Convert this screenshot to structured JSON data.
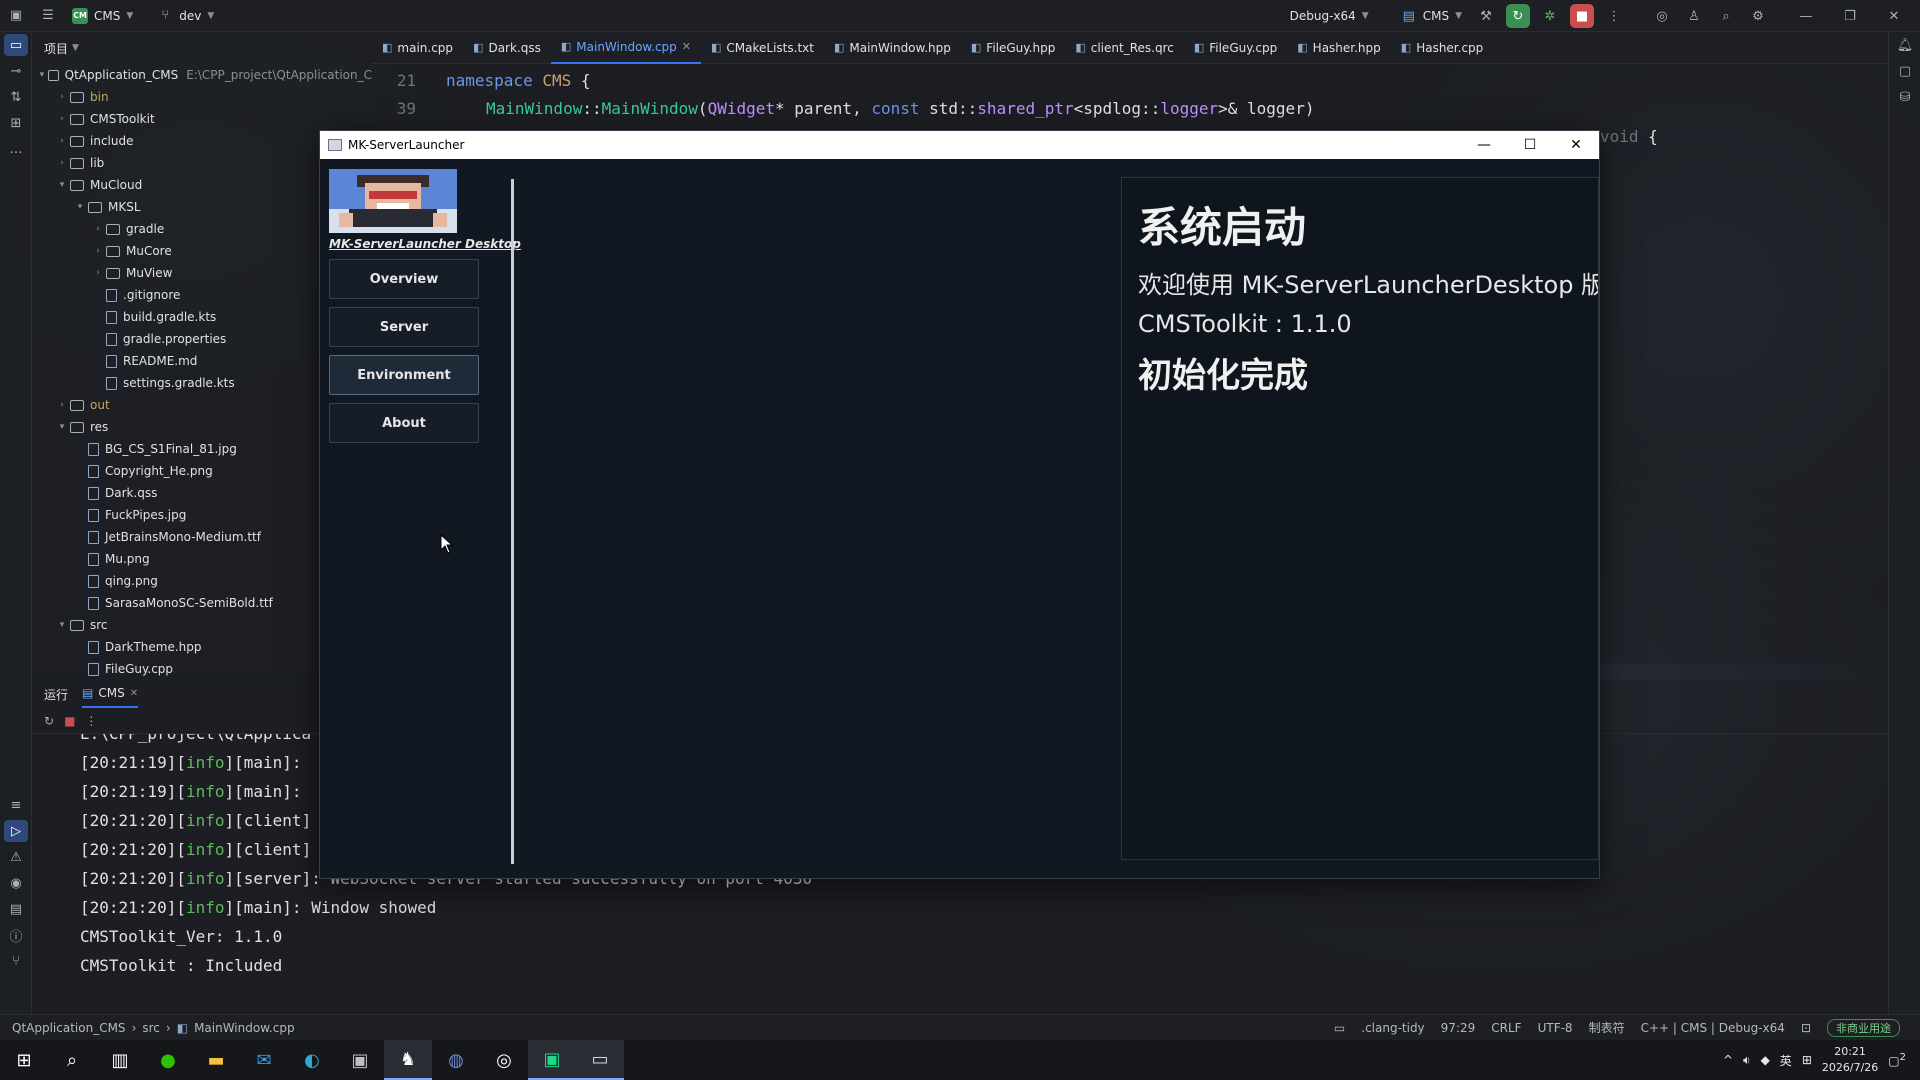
{
  "ide": {
    "project_name": "CMS",
    "branch": "dev",
    "build_config": "Debug-x64",
    "run_config": "CMS",
    "project_panel_title": "项目",
    "root_label": "QtApplication_CMS",
    "root_path": "E:\\CPP_project\\QtApplication_C",
    "tree": [
      {
        "label": "bin",
        "depth": 1,
        "type": "folder",
        "expanded": false,
        "style": "yellow"
      },
      {
        "label": "CMSToolkit",
        "depth": 1,
        "type": "folder",
        "expanded": false
      },
      {
        "label": "include",
        "depth": 1,
        "type": "folder",
        "expanded": false
      },
      {
        "label": "lib",
        "depth": 1,
        "type": "folder",
        "expanded": false
      },
      {
        "label": "MuCloud",
        "depth": 1,
        "type": "folder",
        "expanded": true
      },
      {
        "label": "MKSL",
        "depth": 2,
        "type": "folder",
        "expanded": true
      },
      {
        "label": "gradle",
        "depth": 3,
        "type": "folder",
        "expanded": false
      },
      {
        "label": "MuCore",
        "depth": 3,
        "type": "folder",
        "expanded": false
      },
      {
        "label": "MuView",
        "depth": 3,
        "type": "folder",
        "expanded": false
      },
      {
        "label": ".gitignore",
        "depth": 3,
        "type": "file"
      },
      {
        "label": "build.gradle.kts",
        "depth": 3,
        "type": "file"
      },
      {
        "label": "gradle.properties",
        "depth": 3,
        "type": "file"
      },
      {
        "label": "README.md",
        "depth": 3,
        "type": "file"
      },
      {
        "label": "settings.gradle.kts",
        "depth": 3,
        "type": "file"
      },
      {
        "label": "out",
        "depth": 1,
        "type": "folder",
        "expanded": false,
        "style": "yellow"
      },
      {
        "label": "res",
        "depth": 1,
        "type": "folder",
        "expanded": true
      },
      {
        "label": "BG_CS_S1Final_81.jpg",
        "depth": 2,
        "type": "file"
      },
      {
        "label": "Copyright_He.png",
        "depth": 2,
        "type": "file"
      },
      {
        "label": "Dark.qss",
        "depth": 2,
        "type": "file"
      },
      {
        "label": "FuckPipes.jpg",
        "depth": 2,
        "type": "file"
      },
      {
        "label": "JetBrainsMono-Medium.ttf",
        "depth": 2,
        "type": "file"
      },
      {
        "label": "Mu.png",
        "depth": 2,
        "type": "file"
      },
      {
        "label": "qing.png",
        "depth": 2,
        "type": "file"
      },
      {
        "label": "SarasaMonoSC-SemiBold.ttf",
        "depth": 2,
        "type": "file"
      },
      {
        "label": "src",
        "depth": 1,
        "type": "folder",
        "expanded": true
      },
      {
        "label": "DarkTheme.hpp",
        "depth": 2,
        "type": "file"
      },
      {
        "label": "FileGuy.cpp",
        "depth": 2,
        "type": "file"
      }
    ],
    "tabs": [
      {
        "label": "main.cpp",
        "active": false
      },
      {
        "label": "Dark.qss",
        "active": false
      },
      {
        "label": "MainWindow.cpp",
        "active": true
      },
      {
        "label": "CMakeLists.txt",
        "active": false
      },
      {
        "label": "MainWindow.hpp",
        "active": false
      },
      {
        "label": "FileGuy.hpp",
        "active": false
      },
      {
        "label": "client_Res.qrc",
        "active": false
      },
      {
        "label": "FileGuy.cpp",
        "active": false
      },
      {
        "label": "Hasher.hpp",
        "active": false
      },
      {
        "label": "Hasher.cpp",
        "active": false
      }
    ],
    "code": {
      "line1_no": "21",
      "line1_kw": "namespace",
      "line1_ns": "CMS",
      "line1_rest": " {",
      "line2_no": "39",
      "line2_a": "MainWindow",
      "line2_b": "::",
      "line2_c": "MainWindow",
      "line2_d": "(",
      "line2_e": "QWidget",
      "line2_f": "* parent, ",
      "line2_g": "const",
      "line2_h": " std::",
      "line2_i": "shared_ptr",
      "line2_j": "<spdlog::",
      "line2_k": "logger",
      "line2_l": ">& logger)",
      "line3_tail_kw": "void",
      "line3_tail": " {"
    },
    "run_panel": {
      "tab_run": "运行",
      "tab_cms": "CMS",
      "lines": [
        {
          "pre": "E:\\CPP_project\\QtApplica",
          "lvl": "",
          "post": ""
        },
        {
          "pre": "[20:21:19][",
          "lvl": "info",
          "post": "][main]:"
        },
        {
          "pre": "[20:21:19][",
          "lvl": "info",
          "post": "][main]:"
        },
        {
          "pre": "[20:21:20][",
          "lvl": "info",
          "post": "][client]"
        },
        {
          "pre": "[20:21:20][",
          "lvl": "info",
          "post": "][client]"
        },
        {
          "pre": "[20:21:20][",
          "lvl": "info",
          "post": "][server]: WebSocket server started successfully on port 4030"
        },
        {
          "pre": "[20:21:20][",
          "lvl": "info",
          "post": "][main]: Window showed"
        },
        {
          "pre": "CMSToolkit_Ver: 1.1.0",
          "lvl": "",
          "post": ""
        },
        {
          "pre": "CMSToolkit : Included",
          "lvl": "",
          "post": ""
        }
      ]
    },
    "status": {
      "crumb1": "QtApplication_CMS",
      "crumb2": "src",
      "crumb3": "MainWindow.cpp",
      "tidy": ".clang-tidy",
      "pos": "97:29",
      "eol": "CRLF",
      "enc": "UTF-8",
      "indent": "制表符",
      "lang": "C++ | CMS | Debug-x64",
      "badge": "非商业用途"
    }
  },
  "app": {
    "window_title": "MK-ServerLauncher",
    "brand": "MK-ServerLauncher Desktop",
    "nav": [
      {
        "label": "Overview"
      },
      {
        "label": "Server"
      },
      {
        "label": "Environment"
      },
      {
        "label": "About"
      }
    ],
    "content": {
      "heading": "系统启动",
      "welcome": "欢迎使用 MK-ServerLauncherDesktop 版本",
      "version_line": "CMSToolkit : 1.1.0",
      "status": "初始化完成"
    }
  },
  "taskbar": {
    "time": "20:21",
    "date": "2026/7/26",
    "ime": "英",
    "notif_count": "2"
  },
  "colors": {
    "accent": "#3574f0",
    "info_green": "#5fb85f",
    "app_bg": "#111821"
  }
}
